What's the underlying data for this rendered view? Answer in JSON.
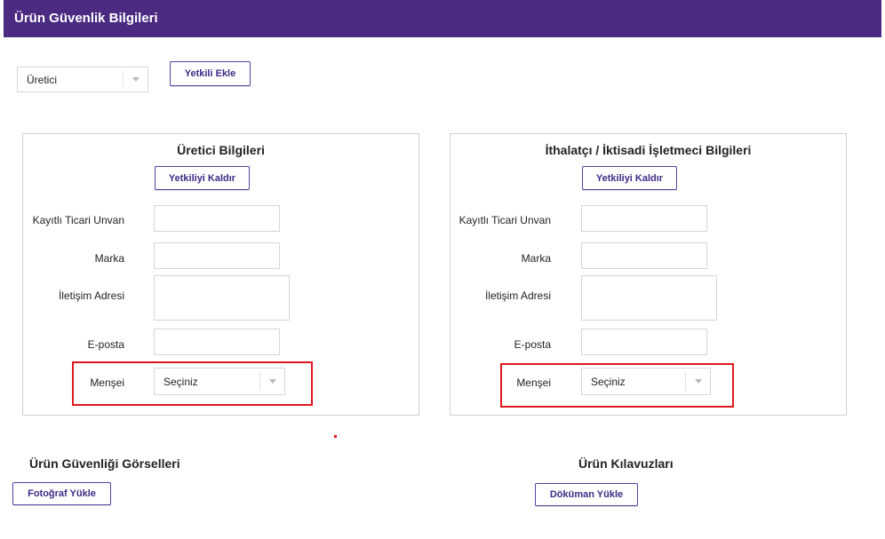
{
  "header": {
    "title": "Ürün Güvenlik Bilgileri"
  },
  "toolbar": {
    "role_select_value": "Üretici",
    "add_authorized_label": "Yetkili Ekle"
  },
  "manufacturer_panel": {
    "title": "Üretici Bilgileri",
    "remove_label": "Yetkiliyi Kaldır",
    "fields": {
      "trade_name_label": "Kayıtlı Ticari Unvan",
      "brand_label": "Marka",
      "address_label": "İletişim Adresi",
      "email_label": "E-posta",
      "origin_label": "Menşei",
      "origin_value": "Seçiniz"
    }
  },
  "importer_panel": {
    "title": "İthalatçı / İktisadi İşletmeci Bilgileri",
    "remove_label": "Yetkiliyi Kaldır",
    "fields": {
      "trade_name_label": "Kayıtlı Ticari Unvan",
      "brand_label": "Marka",
      "address_label": "İletişim Adresi",
      "email_label": "E-posta",
      "origin_label": "Menşei",
      "origin_value": "Seçiniz"
    }
  },
  "images_section": {
    "title": "Ürün Güvenliği Görselleri",
    "upload_label": "Fotoğraf Yükle"
  },
  "guides_section": {
    "title": "Ürün Kılavuzları",
    "upload_label": "Döküman Yükle"
  },
  "colors": {
    "header_bg": "#4b2a82",
    "button_border": "#5a3ea3",
    "button_text": "#3f2a86",
    "highlight": "#e0171f"
  }
}
